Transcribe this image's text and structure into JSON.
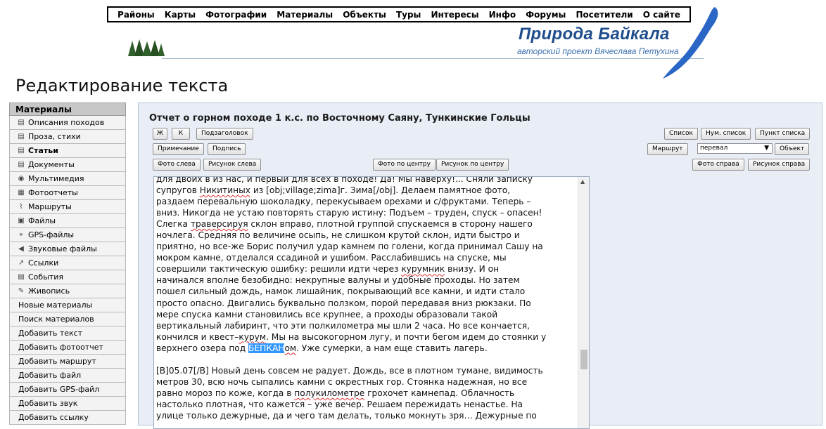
{
  "nav": [
    "Районы",
    "Карты",
    "Фотографии",
    "Материалы",
    "Объекты",
    "Туры",
    "Интересы",
    "Инфо",
    "Форумы",
    "Посетители",
    "О сайте"
  ],
  "brand": {
    "title": "Природа Байкала",
    "subtitle": "авторский проект Вячеслава Петухина"
  },
  "page_title": "Редактирование текста",
  "sidebar": {
    "header": "Материалы",
    "items": [
      {
        "label": "Описания походов",
        "icon": "list-icon"
      },
      {
        "label": "Проза, стихи",
        "icon": "list-icon"
      },
      {
        "label": "Статьи",
        "icon": "list-icon",
        "active": true
      },
      {
        "label": "Документы",
        "icon": "list-icon"
      },
      {
        "label": "Мультимедия",
        "icon": "play-icon"
      },
      {
        "label": "Фотоотчеты",
        "icon": "photo-icon"
      },
      {
        "label": "Маршруты",
        "icon": "route-icon"
      },
      {
        "label": "Файлы",
        "icon": "disk-icon"
      },
      {
        "label": "GPS-файлы",
        "icon": "gps-icon"
      },
      {
        "label": "Звуковые файлы",
        "icon": "speaker-icon"
      },
      {
        "label": "Ссылки",
        "icon": "arrow-icon"
      },
      {
        "label": "События",
        "icon": "list-icon"
      },
      {
        "label": "Живопись",
        "icon": "brush-icon"
      },
      {
        "label": "Новые материалы",
        "icon": ""
      },
      {
        "label": "Поиск материалов",
        "icon": ""
      },
      {
        "label": "Добавить текст",
        "icon": ""
      },
      {
        "label": "Добавить фотоотчет",
        "icon": ""
      },
      {
        "label": "Добавить маршрут",
        "icon": ""
      },
      {
        "label": "Добавить файл",
        "icon": ""
      },
      {
        "label": "Добавить GPS-файл",
        "icon": ""
      },
      {
        "label": "Добавить звук",
        "icon": ""
      },
      {
        "label": "Добавить ссылку",
        "icon": ""
      }
    ]
  },
  "doc_title": "Отчет о горном походе 1 к.с. по Восточному Саяну, Тункинские Гольцы",
  "toolbar": {
    "bold": "Ж",
    "italic": "К",
    "subheading": "Подзаголовок",
    "list": "Список",
    "num_list": "Нум. список",
    "list_item": "Пункт списка",
    "note": "Примечание",
    "caption": "Подпись",
    "route": "Маршрут",
    "object_select_value": "перевал",
    "object": "Объект",
    "photo_left": "Фото слева",
    "pic_left": "Рисунок слева",
    "photo_center": "Фото по центру",
    "pic_center": "Рисунок по центру",
    "photo_right": "Фото справа",
    "pic_right": "Рисунок справа"
  },
  "editor": {
    "line0": "для двоих в из нас, и первый  для всех в походе! Да! Мы наверху!...  Сняли записку",
    "line1_pre": "супругов ",
    "line1_sq": "Никитиных",
    "line1_post": " из [obj;village;zima]г. Зима[/obj].  Делаем памятное фото,",
    "line2": "раздаем перевальную шоколадку, перекусываем орехами и с/фруктами. Теперь –",
    "line3": "вниз. Никогда не устаю повторять старую истину: Подъем – труден, спуск – опасен!",
    "line4_pre": "Слегка ",
    "line4_sq": "траверсируя",
    "line4_post": " склон вправо, плотной группой спускаемся в сторону нашего",
    "line5": "ночлега. Средняя по величине осыпь, не слишком крутой склон, идти быстро и",
    "line6": "приятно, но все-же Борис получил удар камнем по голени, когда принимал Сашу на",
    "line7": "мокром камне, отделался ссадиной и ушибом. Расслабившись на спуске, мы",
    "line8_pre": "совершили тактическую ошибку: решили идти через ",
    "line8_sq": "курумник",
    "line8_post": " внизу.  И он",
    "line9": "начинался вполне безобидно: некрупные валуны и удобные проходы. Но затем",
    "line10": "пошел сильный дождь, намок лишайник, покрывающий все камни, и идти стало",
    "line11": "просто опасно. Двигались буквально ползком, порой передавая вниз рюкзаки. По",
    "line12": "мере спуска камни становились все крупнее, а проходы образовали такой",
    "line13": "вертикальный лабиринт, что эти полкилометра мы шли 2 часа. Но все кончается,",
    "line14_pre": "кончился и квест–",
    "line14_sq": "курум",
    "line14_post": ". Мы на высокогорном лугу, и почти бегом идем до стоянки у",
    "line15_pre": "верхнего озера под ",
    "line15_hl": "БЕПКАН",
    "line15_sq": "ом",
    "line15_post": ". Уже сумерки, а нам еще ставить лагерь.",
    "line17": "[B]05.07[/B]  Новый день совсем не радует. Дождь, все в плотном тумане, видимость",
    "line18": "метров 30, всю ночь сыпались камни с окрестных гор. Стоянка надежная, но все",
    "line19_pre": "равно мороз по коже, когда в ",
    "line19_sq": "полукилометре",
    "line19_post": " грохочет камнепад. Облачность",
    "line20": "настолько плотная, что кажется – уже вечер. Решаем пережидать ненастье. На",
    "line21": "улице только дежурные, да и чего там делать, только мокнуть зря… Дежурные по"
  }
}
